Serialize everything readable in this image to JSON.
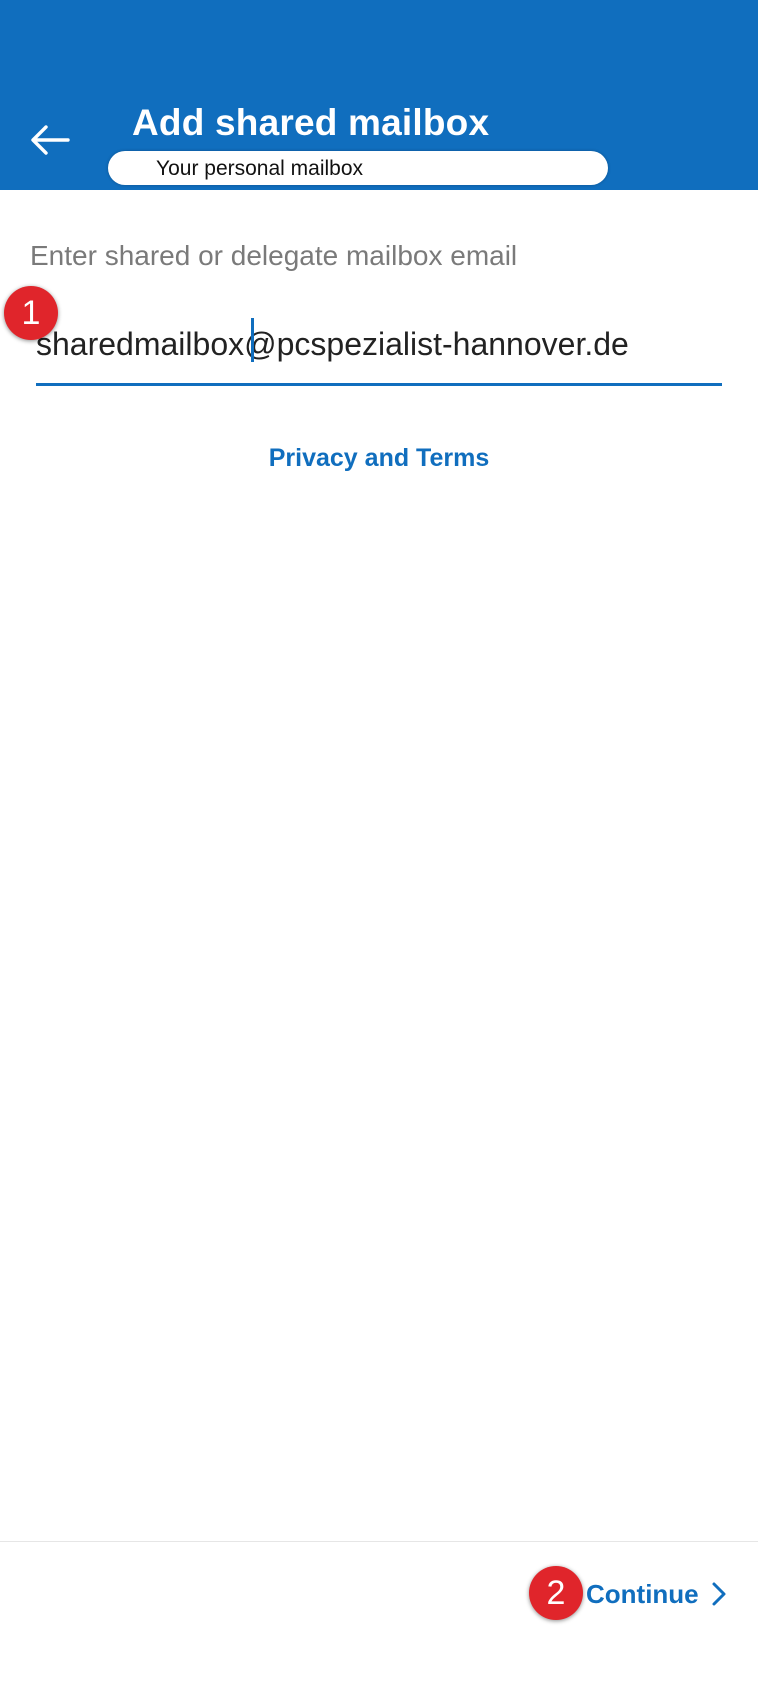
{
  "header": {
    "title": "Add shared mailbox",
    "subtitle": "Your personal mailbox",
    "back_icon": "arrow-left-icon",
    "background_color": "#106ebe"
  },
  "form": {
    "label": "Enter shared or delegate mailbox email",
    "email_value": "sharedmailbox@pcspezialist-hannover.de",
    "accent_color": "#106ebe"
  },
  "links": {
    "privacy_terms": "Privacy and Terms"
  },
  "footer": {
    "continue_label": "Continue",
    "continue_icon": "chevron-right-icon"
  },
  "annotations": {
    "step_1": "1",
    "step_2": "2",
    "badge_color": "#e0252b"
  }
}
